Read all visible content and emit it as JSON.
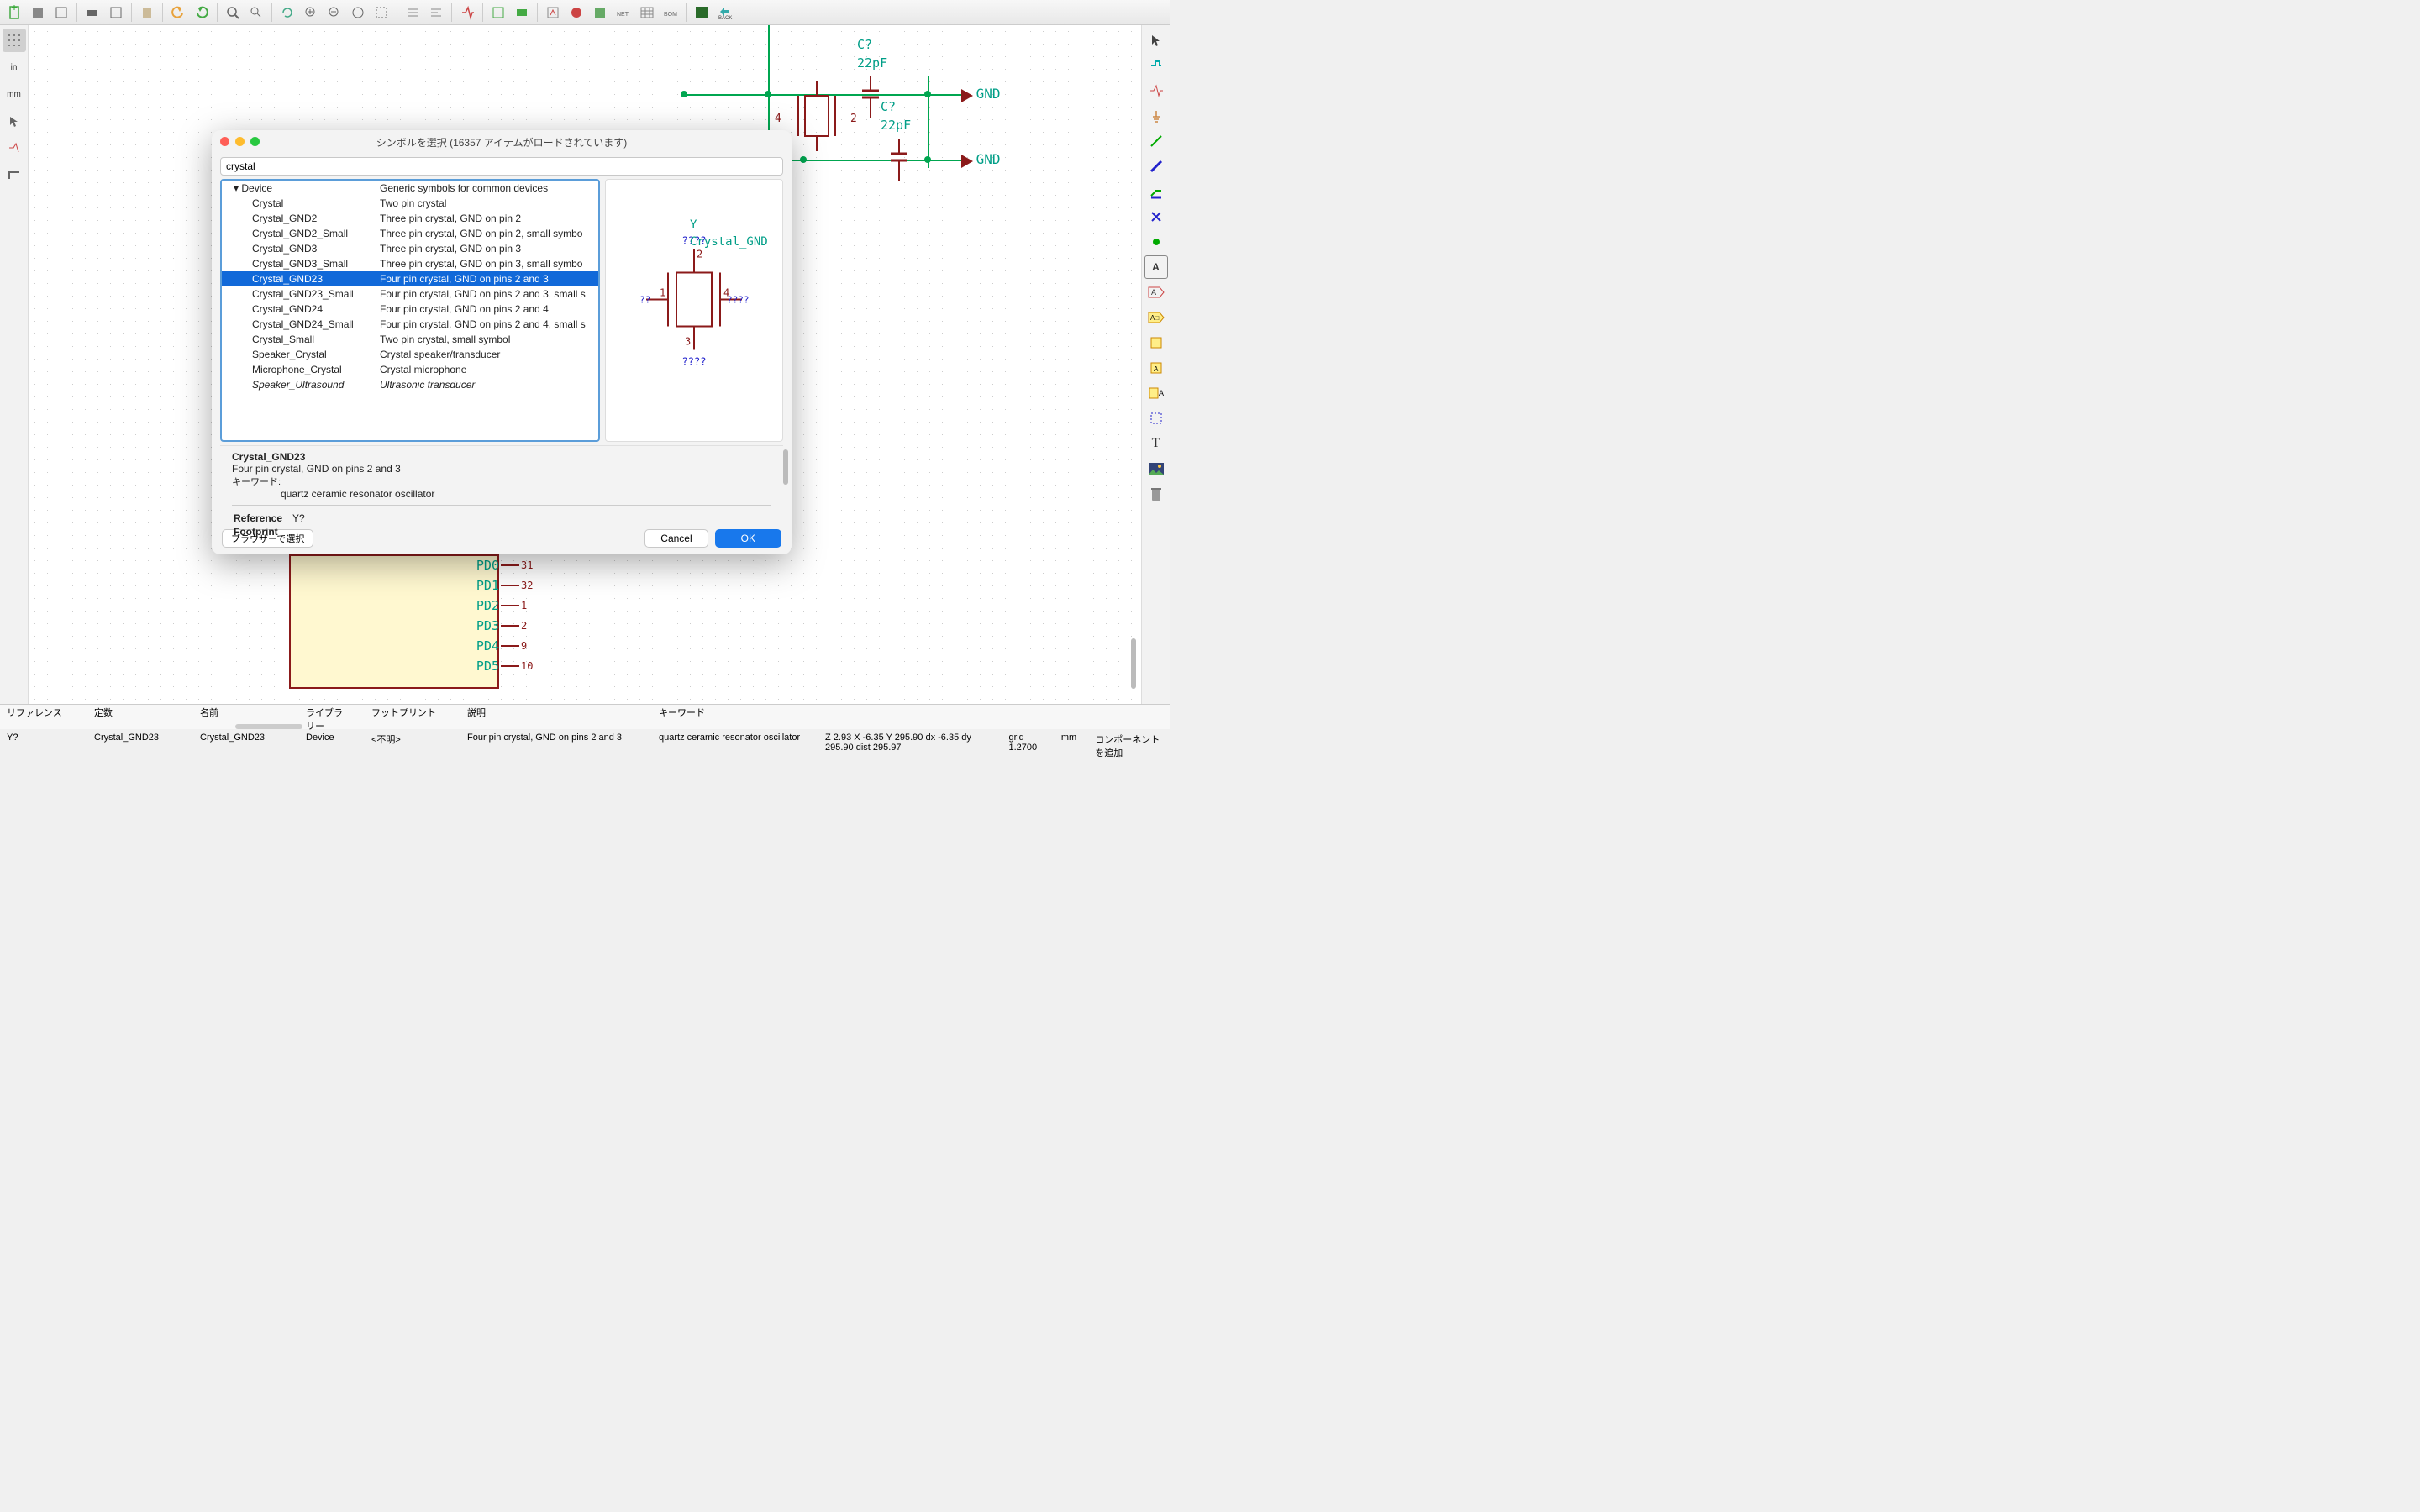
{
  "dialog": {
    "title": "シンボルを選択 (16357 アイテムがロードされています)",
    "search": "crystal",
    "library_header": {
      "name": "Device",
      "desc": "Generic symbols for common devices"
    },
    "rows": [
      {
        "name": "Crystal",
        "desc": "Two pin crystal"
      },
      {
        "name": "Crystal_GND2",
        "desc": "Three pin crystal, GND on pin 2"
      },
      {
        "name": "Crystal_GND2_Small",
        "desc": "Three pin crystal, GND on pin 2, small symbo"
      },
      {
        "name": "Crystal_GND3",
        "desc": "Three pin crystal, GND on pin 3"
      },
      {
        "name": "Crystal_GND3_Small",
        "desc": "Three pin crystal, GND on pin 3, small symbo"
      },
      {
        "name": "Crystal_GND23",
        "desc": "Four pin crystal, GND on pins 2 and 3",
        "sel": true
      },
      {
        "name": "Crystal_GND23_Small",
        "desc": "Four pin crystal, GND on pins 2 and 3, small s"
      },
      {
        "name": "Crystal_GND24",
        "desc": "Four pin crystal, GND on pins 2 and 4"
      },
      {
        "name": "Crystal_GND24_Small",
        "desc": "Four pin crystal, GND on pins 2 and 4, small s"
      },
      {
        "name": "Crystal_Small",
        "desc": "Two pin crystal, small symbol"
      },
      {
        "name": "Speaker_Crystal",
        "desc": "Crystal speaker/transducer"
      },
      {
        "name": "Microphone_Crystal",
        "desc": "Crystal microphone"
      },
      {
        "name": "Speaker_Ultrasound",
        "desc": "Ultrasonic transducer",
        "italic": true
      }
    ],
    "details": {
      "title": "Crystal_GND23",
      "desc": "Four pin crystal, GND on pins 2 and 3",
      "kw_label": "キーワード:",
      "kw": "quartz ceramic resonator oscillator",
      "ref_label": "Reference",
      "ref_val": "Y?",
      "fp_label": "Footprint"
    },
    "browser_btn": "ブラウザーで選択",
    "cancel": "Cancel",
    "ok": "OK",
    "preview": {
      "ref": "Y",
      "val": "Crystal_GND",
      "p1": "1",
      "p2": "2",
      "p3": "3",
      "p4": "4",
      "q": "????"
    }
  },
  "schematic": {
    "c1_ref": "C?",
    "c1_val": "22pF",
    "c2_ref": "C?",
    "c2_val": "22pF",
    "gnd": "GND",
    "pins": [
      "PD0",
      "PD1",
      "PD2",
      "PD3",
      "PD4",
      "PD5"
    ],
    "pinnums": [
      "31",
      "32",
      "1",
      "2",
      "9",
      "10"
    ]
  },
  "status": {
    "h": [
      "リファレンス",
      "定数",
      "名前",
      "ライブラリー",
      "フットプリント",
      "説明",
      "キーワード"
    ],
    "v": [
      "Y?",
      "Crystal_GND23",
      "Crystal_GND23",
      "Device",
      "<不明>",
      "Four pin crystal, GND on pins 2 and 3",
      "quartz ceramic resonator oscillator"
    ],
    "coords": "Z 2.93      X -6.35  Y 295.90        dx -6.35  dy 295.90  dist 295.97",
    "grid": "grid 1.2700",
    "unit": "mm",
    "msg": "コンポーネントを追加"
  }
}
